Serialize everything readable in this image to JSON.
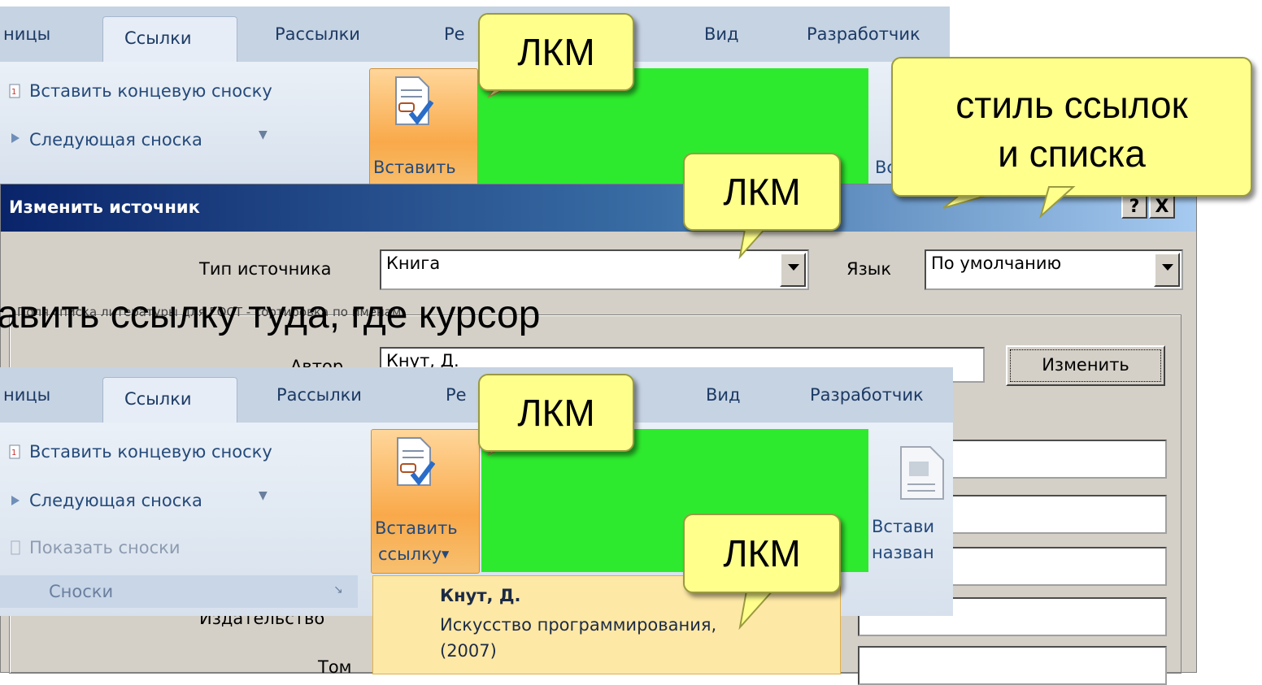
{
  "ribbon_top": {
    "tabs": [
      "ницы",
      "Ссылки",
      "Рассылки",
      "Ре",
      "Вид",
      "Разработчик"
    ],
    "commands": {
      "insert_endnote": "Вставить концевую сноску",
      "next_footnote": "Следующая сноска",
      "insert_label": "Вставить",
      "right_partial": "Вс"
    }
  },
  "ribbon_bottom": {
    "tabs": [
      "ницы",
      "Ссылки",
      "Рассылки",
      "Ре",
      "Вид",
      "Разработчик"
    ],
    "commands": {
      "insert_endnote": "Вставить концевую сноску",
      "next_footnote": "Следующая сноска",
      "show_notes": "Показать сноски",
      "insert_citation_line1": "Вставить",
      "insert_citation_line2": "ссылку",
      "insert_caption_line1": "Встави",
      "insert_caption_line2": "назван"
    },
    "group_label": "Сноски"
  },
  "dialog": {
    "title": "Изменить источник",
    "help_button": "?",
    "close_button": "X",
    "source_type_label": "Тип источника",
    "source_type_value": "Книга",
    "language_label": "Язык",
    "language_value": "По умолчанию",
    "fields_caption": "Поля списка литературы для ГОСТ - сортировка по именам",
    "author_label": "Автор",
    "author_value": "Кнут, Д.",
    "edit_button": "Изменить",
    "publisher_label": "Издательство",
    "volume_label": "Том"
  },
  "slide_text": "бавить ссылку туда, где курсор",
  "gallery_item": {
    "name": "Кнут, Д.",
    "title": "Искусство программирования,",
    "year": "(2007)"
  },
  "callouts": {
    "lkm_1": "ЛКМ",
    "lkm_2": "ЛКМ",
    "lkm_3": "ЛКМ",
    "lkm_4": "ЛКМ",
    "style_line1": "стиль ссылок",
    "style_line2": "и списка"
  },
  "colors": {
    "green_block": "#2eea2e",
    "callout_fill": "#ffff8c",
    "ribbon_button_highlight": "#f9a94a"
  }
}
